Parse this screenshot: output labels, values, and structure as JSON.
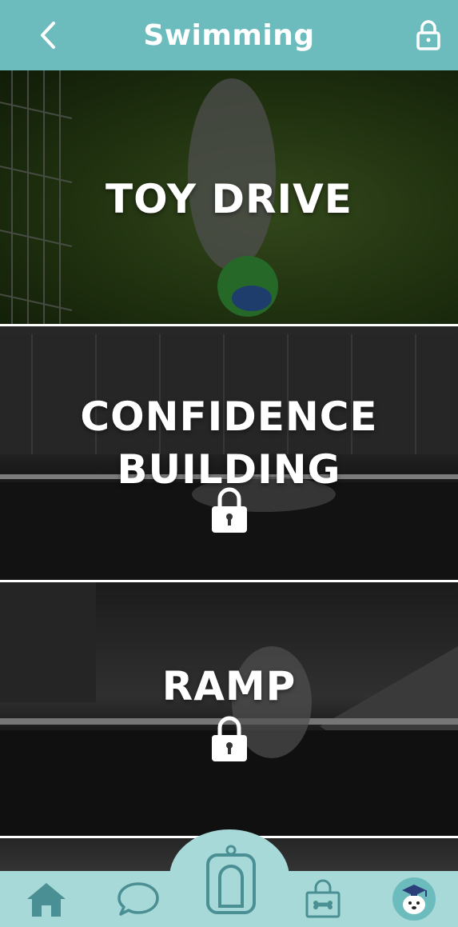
{
  "header": {
    "title": "Swimming",
    "back_icon": "chevron-left-icon",
    "lock_icon": "lock-icon"
  },
  "cards": [
    {
      "label": "TOY DRIVE",
      "locked": false
    },
    {
      "label_lines": [
        "CONFIDENCE",
        "BUILDING"
      ],
      "locked": true
    },
    {
      "label": "RAMP",
      "locked": true
    },
    {
      "label": "",
      "locked": false
    }
  ],
  "tabbar": {
    "items": [
      {
        "icon": "home-icon"
      },
      {
        "icon": "chat-bubble-icon"
      },
      {
        "icon": "clicker-icon"
      },
      {
        "icon": "shopping-bag-icon"
      },
      {
        "icon": "avatar-graduate-dog-icon"
      }
    ]
  },
  "colors": {
    "header": "#6cbcbd",
    "tabbar": "#a8d9d9",
    "icon_stroke": "#4a8f93",
    "home_fill": "#4a8f93"
  }
}
